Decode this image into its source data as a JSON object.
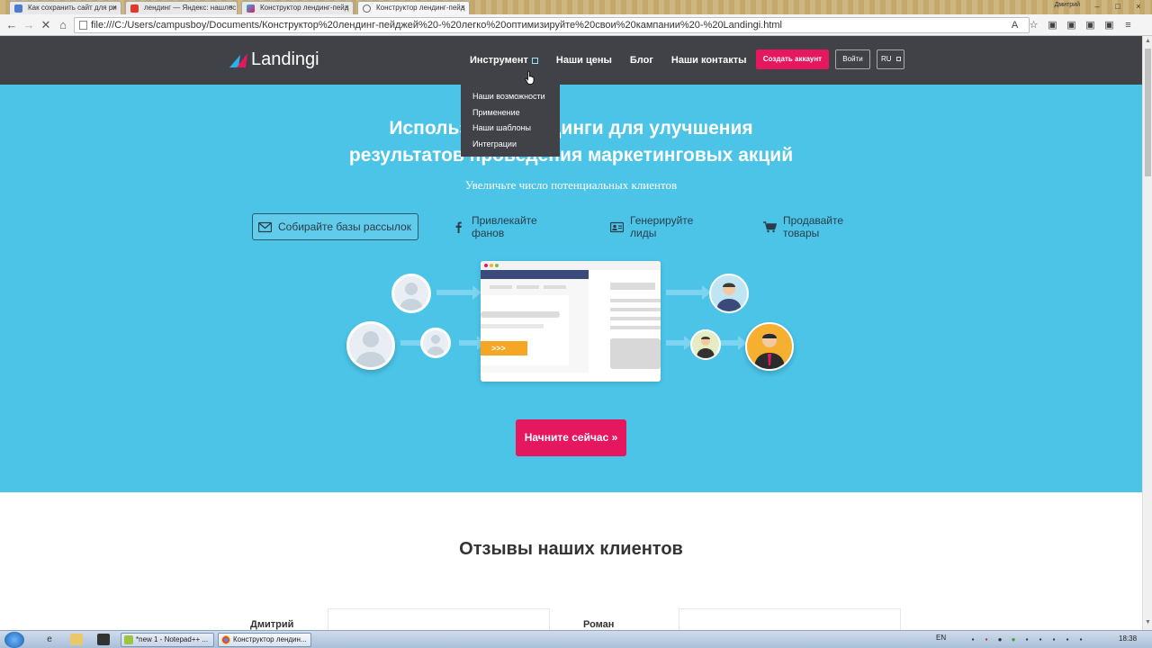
{
  "browser": {
    "tabs": [
      {
        "label": "Как сохранить сайт для ри"
      },
      {
        "label": "лендинг — Яндекс: нашлос"
      },
      {
        "label": "Конструктор лендинг-пейд"
      },
      {
        "label": "Конструктор лендинг-пейд"
      }
    ],
    "tab_close": "×",
    "user_label": "Дмитрий",
    "window_buttons": {
      "min": "–",
      "max": "□",
      "close": "×"
    },
    "nav": {
      "back": "←",
      "forward": "→",
      "stop": "✕",
      "home": "⌂"
    },
    "address": "file:///C:/Users/campusboy/Documents/Конструктор%20лендинг-пейджей%20-%20легко%20оптимизируйте%20свои%20кампании%20-%20Landingi.html",
    "toolbar_icons": [
      "translate-icon",
      "star-icon",
      "extension-icon",
      "extension-icon",
      "extension-icon",
      "extension-icon",
      "menu-icon"
    ],
    "toolbar_glyphs": [
      "A",
      "☆",
      "▣",
      "▣",
      "▣",
      "▣",
      "≡"
    ]
  },
  "site": {
    "logo_text": "Landingi",
    "menu": [
      {
        "label": "Инструмент"
      },
      {
        "label": "Наши цены"
      },
      {
        "label": "Блог"
      },
      {
        "label": "Наши контакты"
      }
    ],
    "create_account": "Создать аккаунт",
    "login": "Войти",
    "lang": "RU",
    "dropdown": [
      {
        "label": "Наши возможности"
      },
      {
        "label": "Применение"
      },
      {
        "label": "Наши шаблоны"
      },
      {
        "label": "Интеграции"
      }
    ]
  },
  "hero": {
    "headline_line1": "Используйте лендинги для улучшения",
    "headline_line2": "результатов проведения маркетинговых акций",
    "subline": "Увеличьте число потенциальных клиентов",
    "features": [
      {
        "label": "Собирайте базы рассылок",
        "icon": "mail-icon"
      },
      {
        "label": "Привлекайте фанов",
        "icon": "facebook-icon"
      },
      {
        "label": "Генерируйте лиды",
        "icon": "id-card-icon"
      },
      {
        "label": "Продавайте товары",
        "icon": "cart-icon"
      }
    ],
    "illustration_button": ">>>",
    "cta": "Начните сейчас »"
  },
  "reviews": {
    "title": "Отзывы наших клиентов",
    "names": [
      "Дмитрий",
      "Роман"
    ]
  },
  "taskbar": {
    "tasks": [
      {
        "label": "*new 1 - Notepad++ ..."
      },
      {
        "label": "Конструктор лендин..."
      }
    ],
    "lang": "EN",
    "time": "18:38"
  },
  "colors": {
    "hero_bg": "#4bc4e8",
    "nav_bg": "#414148",
    "accent": "#e5175e"
  }
}
